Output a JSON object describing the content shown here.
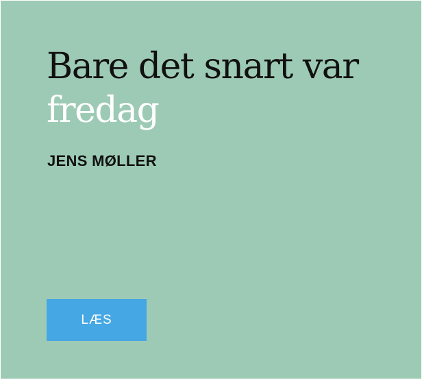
{
  "article": {
    "title_line1": "Bare det snart var",
    "title_line2": "fredag",
    "author": "JENS MØLLER",
    "read_button_label": "LÆS"
  },
  "colors": {
    "background": "#9dcab5",
    "title_text": "#111111",
    "title_highlight": "#ffffff",
    "button": "#45a7e3",
    "button_text": "#ffffff"
  }
}
